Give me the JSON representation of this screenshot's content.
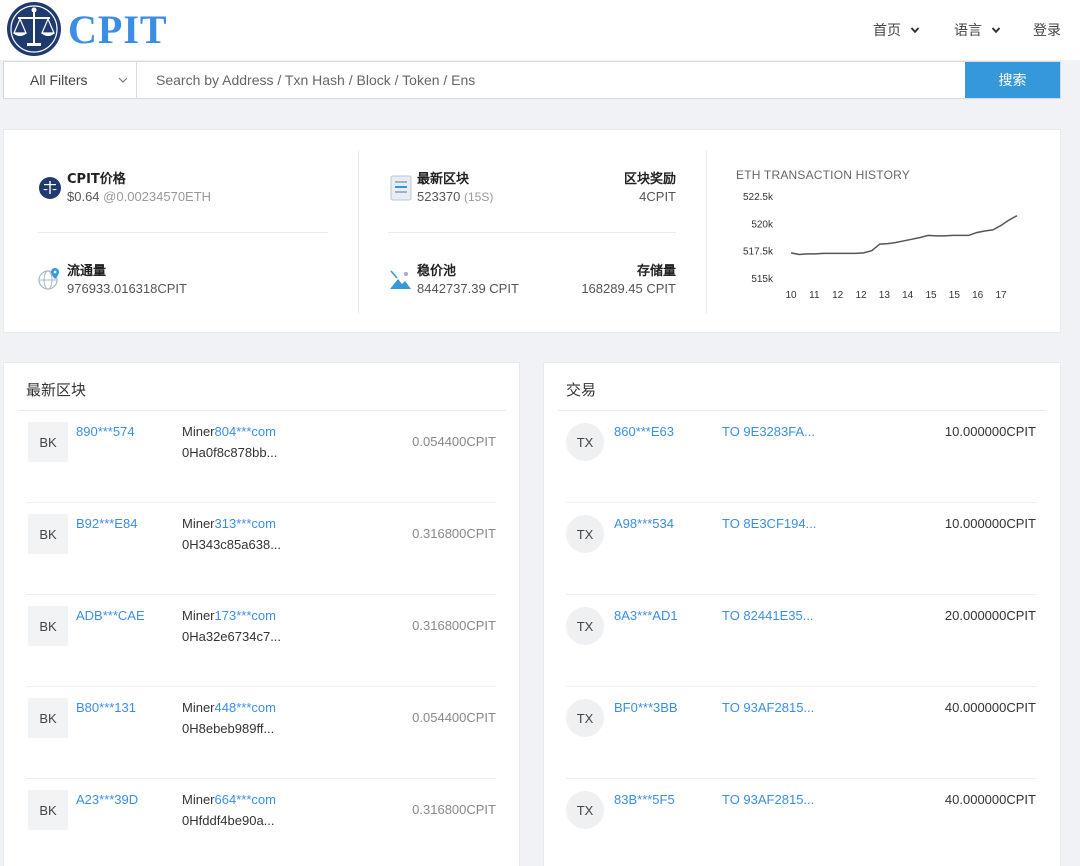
{
  "brand": {
    "name": "CPIT"
  },
  "nav": {
    "home": "首页",
    "language": "语言",
    "login": "登录"
  },
  "search": {
    "filter_label": "All Filters",
    "placeholder": "Search by Address / Txn Hash / Block / Token / Ens",
    "value": "",
    "button_label": "搜索"
  },
  "stats": {
    "price": {
      "title": "CPIT价格",
      "value": "$0.64",
      "sub": "@0.00234570ETH",
      "icon": "coin-icon"
    },
    "supply": {
      "title": "流通量",
      "value": "976933.016318CPIT",
      "icon": "globe-pin-icon"
    },
    "latest_block": {
      "title": "最新区块",
      "value": "523370",
      "sub": "(15S)",
      "icon": "document-icon"
    },
    "block_reward": {
      "title": "区块奖励",
      "value": "4CPIT"
    },
    "stable_pool": {
      "title": "稳价池",
      "value": "8442737.39 CPIT",
      "icon": "mountain-icon"
    },
    "storage": {
      "title": "存储量",
      "value": "168289.45 CPIT"
    }
  },
  "chart_data": {
    "type": "line",
    "title": "ETH TRANSACTION HISTORY",
    "x_ticks": [
      "10",
      "11",
      "12",
      "12",
      "13",
      "14",
      "15",
      "15",
      "16",
      "17"
    ],
    "y_ticks": [
      "522.5k",
      "520k",
      "517.5k",
      "515k"
    ],
    "ylim": [
      515000,
      522500
    ],
    "values": [
      517300,
      517150,
      517200,
      517200,
      517250,
      517250,
      517250,
      517250,
      517250,
      517300,
      517500,
      518100,
      518150,
      518250,
      518400,
      518550,
      518700,
      518900,
      518850,
      518850,
      518900,
      518900,
      518900,
      519150,
      519300,
      519400,
      519800,
      520300,
      520700
    ],
    "color": "#555555"
  },
  "blocks_panel": {
    "title": "最新区块",
    "badge": "BK",
    "miner_prefix": "Miner",
    "rows": [
      {
        "id": "890***574",
        "miner": "804***com",
        "hash": "0Ha0f8c878bb...",
        "amount": "0.054400CPIT"
      },
      {
        "id": "B92***E84",
        "miner": "313***com",
        "hash": "0H343c85a638...",
        "amount": "0.316800CPIT"
      },
      {
        "id": "ADB***CAE",
        "miner": "173***com",
        "hash": "0Ha32e6734c7...",
        "amount": "0.316800CPIT"
      },
      {
        "id": "B80***131",
        "miner": "448***com",
        "hash": "0H8ebeb989ff...",
        "amount": "0.054400CPIT"
      },
      {
        "id": "A23***39D",
        "miner": "664***com",
        "hash": "0Hfddf4be90a...",
        "amount": "0.316800CPIT"
      }
    ]
  },
  "tx_panel": {
    "title": "交易",
    "badge": "TX",
    "rows": [
      {
        "id": "860***E63",
        "to": "TO 9E3283FA...",
        "amount": "10.000000CPIT"
      },
      {
        "id": "A98***534",
        "to": "TO 8E3CF194...",
        "amount": "10.000000CPIT"
      },
      {
        "id": "8A3***AD1",
        "to": "TO 82441E35...",
        "amount": "20.000000CPIT"
      },
      {
        "id": "BF0***3BB",
        "to": "TO 93AF2815...",
        "amount": "40.000000CPIT"
      },
      {
        "id": "83B***5F5",
        "to": "TO 93AF2815...",
        "amount": "40.000000CPIT"
      }
    ]
  },
  "colors": {
    "accent": "#3498db",
    "link": "#3a8ee6",
    "brand": "#3a8ee6"
  }
}
